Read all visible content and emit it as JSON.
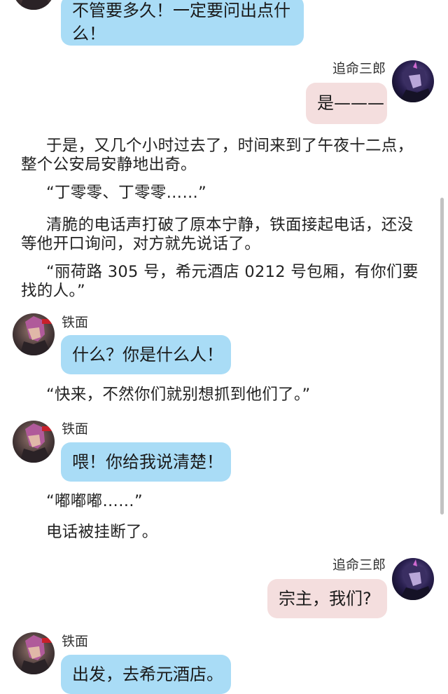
{
  "speakers": {
    "left": {
      "name": "铁面",
      "avatar_icon": "tiemian-avatar-icon"
    },
    "right": {
      "name": "追命三郎",
      "avatar_icon": "zhuiming-avatar-icon"
    }
  },
  "colors": {
    "left_bubble": "#a9dcf6",
    "right_bubble": "#f4dede"
  },
  "messages": [
    {
      "id": "m1",
      "side": "left",
      "text": "不管要多久！一定要问出点什么！"
    },
    {
      "id": "m2",
      "side": "right",
      "name": "追命三郎",
      "text": "是———"
    },
    {
      "id": "n1",
      "side": "narration",
      "text": "于是，又几个小时过去了，时间来到了午夜十二点，整个公安局安静地出奇。"
    },
    {
      "id": "n2",
      "side": "narration",
      "text": "“丁零零、丁零零……”"
    },
    {
      "id": "n3",
      "side": "narration",
      "text": "清脆的电话声打破了原本宁静，铁面接起电话，还没等他开口询问，对方就先说话了。"
    },
    {
      "id": "n4",
      "side": "narration",
      "text": "“丽荷路 305 号，希元酒店 0212 号包厢，有你们要找的人。”"
    },
    {
      "id": "m3",
      "side": "left",
      "name": "铁面",
      "text": "什么？你是什么人！"
    },
    {
      "id": "n5",
      "side": "narration",
      "text": "“快来，不然你们就别想抓到他们了。”"
    },
    {
      "id": "m4",
      "side": "left",
      "name": "铁面",
      "text": "喂！你给我说清楚！"
    },
    {
      "id": "n6",
      "side": "narration",
      "text": "“嘟嘟嘟……”"
    },
    {
      "id": "n7",
      "side": "narration",
      "text": "电话被挂断了。"
    },
    {
      "id": "m5",
      "side": "right",
      "name": "追命三郎",
      "text": "宗主，我们?"
    },
    {
      "id": "m6",
      "side": "left",
      "name": "铁面",
      "text": "出发，去希元酒店。"
    }
  ]
}
